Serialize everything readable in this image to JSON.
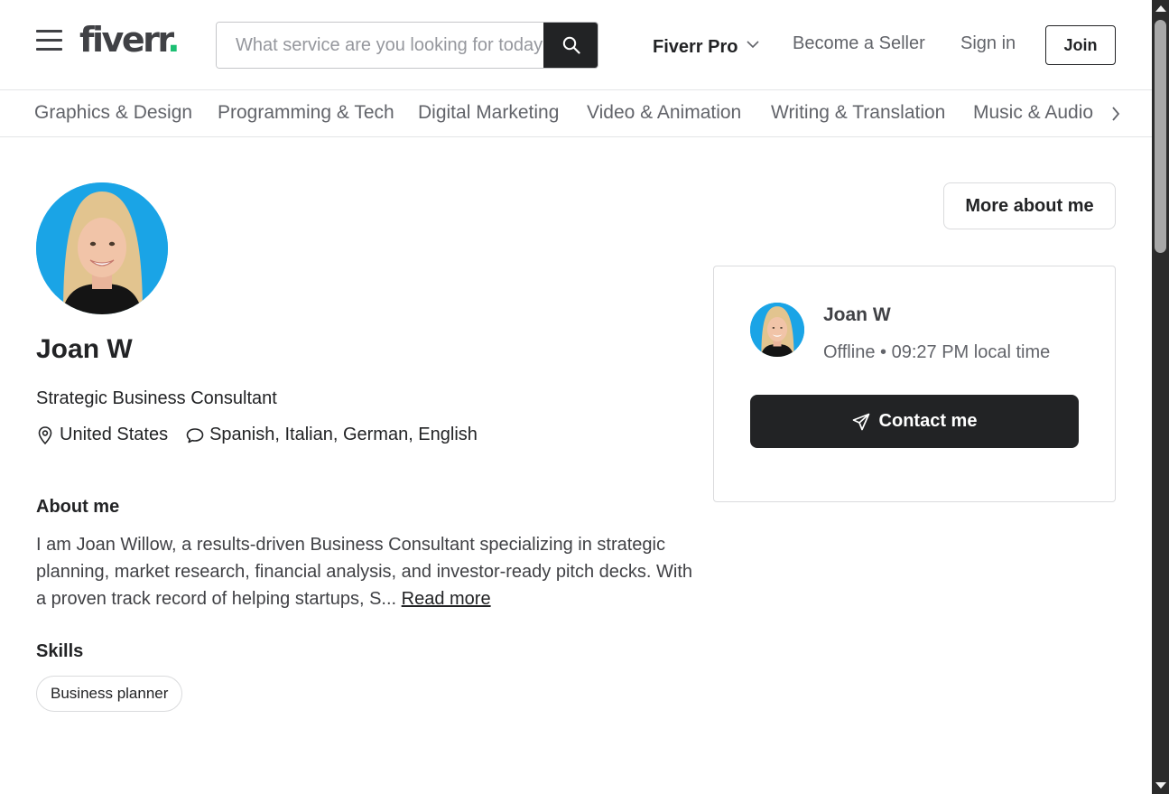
{
  "header": {
    "logo_text": "fiverr",
    "logo_dot": ".",
    "search_placeholder": "What service are you looking for today?",
    "nav": {
      "pro": "Fiverr Pro",
      "seller": "Become a Seller",
      "signin": "Sign in",
      "join": "Join"
    }
  },
  "categories": [
    "Graphics & Design",
    "Programming & Tech",
    "Digital Marketing",
    "Video & Animation",
    "Writing & Translation",
    "Music & Audio"
  ],
  "profile": {
    "name": "Joan W",
    "title": "Strategic Business Consultant",
    "location": "United States",
    "languages": "Spanish, Italian, German, English",
    "about_heading": "About me",
    "about_text": "I am Joan Willow, a results-driven Business Consultant specializing in strategic planning, market research, financial analysis, and investor-ready pitch decks. With a proven track record of helping startups, S... ",
    "read_more": "Read more",
    "skills_heading": "Skills",
    "skills": [
      "Business planner"
    ]
  },
  "sidebar": {
    "more_about": "More about me",
    "card_name": "Joan W",
    "status": "Offline",
    "status_separator": "•",
    "local_time": "09:27 PM local time",
    "contact": "Contact me"
  },
  "colors": {
    "brand_green": "#1dbf73",
    "dark": "#222325",
    "avatar_bg": "#1aa4e6"
  },
  "icons": {
    "menu": "hamburger-icon",
    "search": "search-icon",
    "chevron": "chevron-down-icon",
    "next": "chevron-right-icon",
    "location": "location-pin-icon",
    "language": "speech-bubble-icon",
    "send": "paper-plane-icon"
  }
}
